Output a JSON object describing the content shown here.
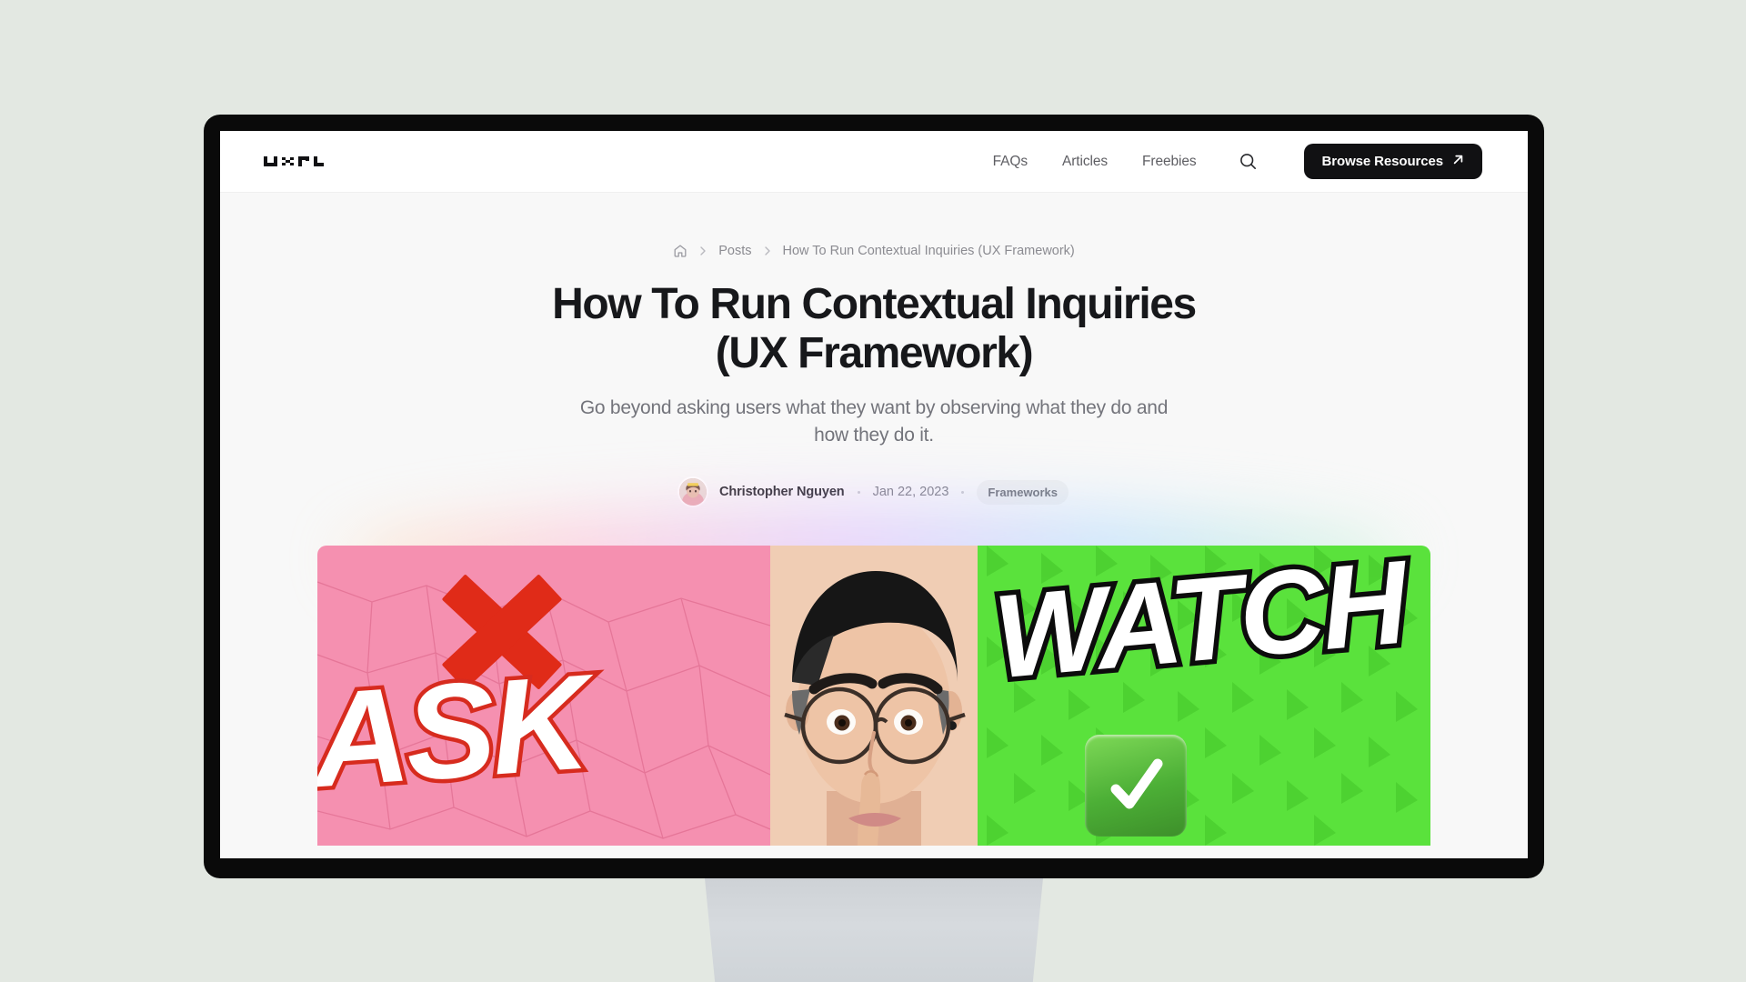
{
  "site": {
    "logo_text": "UXPL",
    "logo_icon": "uxpl-pixel-logo"
  },
  "nav": {
    "links": [
      {
        "label": "FAQs"
      },
      {
        "label": "Articles"
      },
      {
        "label": "Freebies"
      }
    ],
    "search_icon": "search-icon",
    "cta": {
      "label": "Browse Resources",
      "icon": "arrow-up-right-icon"
    }
  },
  "breadcrumb": {
    "home_icon": "home-icon",
    "separator": "chevron-right-icon",
    "items": [
      {
        "label": "Posts"
      },
      {
        "label": "How To Run Contextual Inquiries (UX Framework)"
      }
    ]
  },
  "article": {
    "title": "How To Run Contextual Inquiries (UX Framework)",
    "subtitle": "Go beyond asking users what they want by observing what they do and how they do it.",
    "author": "Christopher Nguyen",
    "date": "Jan 22, 2023",
    "category": "Frameworks"
  },
  "hero": {
    "left_label": "ASK",
    "left_mark": "red-x-icon",
    "right_label": "WATCH",
    "right_mark": "green-check-icon",
    "subject": "person-shushing-photo"
  },
  "colors": {
    "page_background": "#e3e8e2",
    "bezel": "#0a0a0a",
    "screen_background": "#f8f8f8",
    "header_background": "#ffffff",
    "cta_background": "#111113",
    "title_color": "#17181b",
    "muted_text": "#73747b",
    "hero_pink": "#f590b0",
    "hero_green": "#5ae23c",
    "hero_red": "#d72b1e"
  }
}
